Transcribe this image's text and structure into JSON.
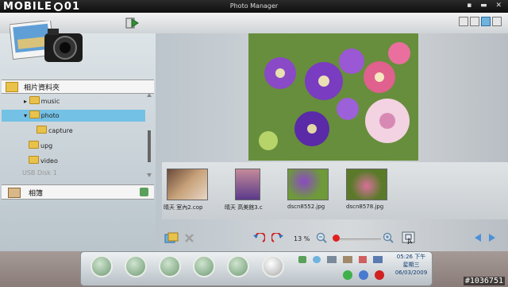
{
  "brand": {
    "logo_left": "MOBILE",
    "logo_right": "01"
  },
  "app": {
    "title": "Photo Manager",
    "window_controls": "▪ ▬ ✕"
  },
  "tree": {
    "header": "相片資料夾",
    "items": [
      {
        "label": "music"
      },
      {
        "label": "photo"
      },
      {
        "label": "capture"
      },
      {
        "label": "upg"
      },
      {
        "label": "video"
      },
      {
        "label": "USB Disk 1"
      }
    ]
  },
  "album": {
    "label": "相簿"
  },
  "thumbnails": [
    {
      "label": "晴天 室內2.cop"
    },
    {
      "label": "晴天 高美館3.c"
    },
    {
      "label": "dscn8552.jpg"
    },
    {
      "label": "dscn8578.jpg"
    }
  ],
  "zoom": {
    "percent_label": "13 %",
    "value": 13
  },
  "clock": {
    "time": "05:26 下午",
    "weekday": "星期三",
    "date": "06/03/2009"
  },
  "watermark": "#1036751",
  "colors": {
    "selection": "#74c1e6",
    "zoom_knob": "#e02020",
    "dock_icon": "#6f9a74"
  },
  "icons": [
    "forward-arrow-icon",
    "view-list-icon",
    "view-grid-icon",
    "view-detail-icon",
    "camera-icon",
    "folder-icon",
    "album-icon",
    "rotate-left-icon",
    "rotate-right-icon",
    "zoom-out-icon",
    "zoom-in-icon",
    "fit-icon",
    "prev-icon",
    "next-icon",
    "delete-icon",
    "tools-icon",
    "music-icon",
    "photos-icon",
    "settings-icon"
  ]
}
